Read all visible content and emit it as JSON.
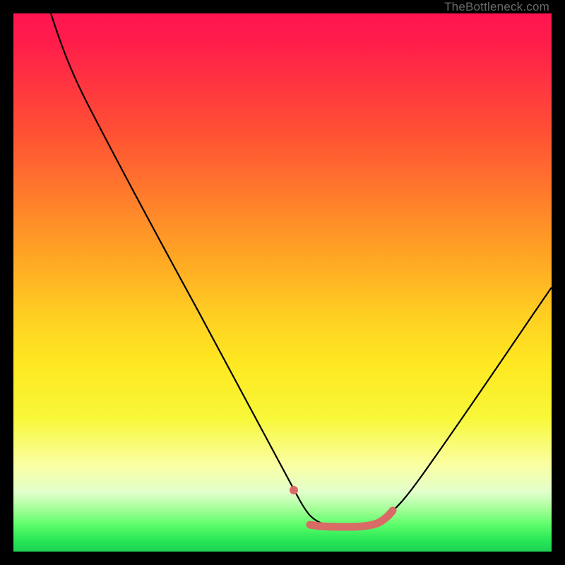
{
  "watermark": "TheBottleneck.com",
  "colors": {
    "curve_stroke": "#000000",
    "highlight_stroke": "#d96a66",
    "highlight_dot": "#d96a66"
  },
  "chart_data": {
    "type": "line",
    "title": "",
    "xlabel": "",
    "ylabel": "",
    "xlim": [
      0,
      100
    ],
    "ylim": [
      0,
      100
    ],
    "series": [
      {
        "name": "curve",
        "x": [
          7,
          10,
          14,
          18,
          22,
          26,
          30,
          34,
          38,
          42,
          46,
          50,
          53,
          55,
          57,
          59,
          61,
          63,
          65,
          67,
          70,
          74,
          78,
          82,
          86,
          90,
          94,
          98,
          100
        ],
        "y": [
          100,
          94,
          87,
          79,
          72,
          64,
          57,
          49,
          42,
          34,
          27,
          19,
          13,
          10,
          8,
          6.5,
          5.5,
          5,
          5,
          5.2,
          6,
          9,
          14,
          20,
          26,
          33,
          40,
          47,
          51
        ]
      }
    ],
    "highlight": {
      "dot": {
        "x": 52,
        "y": 14
      },
      "segment_x": [
        55,
        67
      ],
      "segment_y": [
        5,
        5.2
      ]
    }
  }
}
